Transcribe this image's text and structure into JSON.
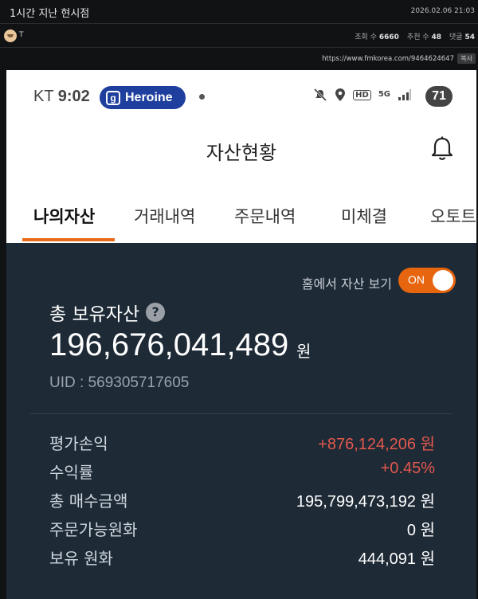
{
  "post": {
    "title": "1시간 지난 현시점",
    "date": "2026.02.06 21:03",
    "author": "T",
    "stats": {
      "views_label": "조회 수",
      "views": "6660",
      "likes_label": "추천 수",
      "likes": "48",
      "comments_label": "댓글",
      "comments": "54"
    },
    "url": "https://www.fmkorea.com/9464624647",
    "copy_label": "복사"
  },
  "phone": {
    "statusbar": {
      "carrier": "KT",
      "time": "9:02",
      "pill_label": "Heroine",
      "pill_icon": "g",
      "network": "5G",
      "hd": "HD",
      "battery": "71"
    },
    "app_title": "자산현황",
    "tabs": [
      "나의자산",
      "거래내역",
      "주문내역",
      "미체결",
      "오토트"
    ],
    "active_tab": 0,
    "toggle": {
      "label": "홈에서 자산 보기",
      "state": "ON"
    },
    "total": {
      "label": "총 보유자산",
      "amount": "196,676,041,489",
      "unit": "원",
      "uid": "UID : 569305717605"
    },
    "rows": [
      {
        "label": "평가손익",
        "value": "+876,124,206 원",
        "color": "#e2584d"
      },
      {
        "label": "수익률",
        "value": "+0.45%",
        "color": "#e2584d"
      },
      {
        "label": "총 매수금액",
        "value": "195,799,473,192 원",
        "color": "#ffffff"
      },
      {
        "label": "주문가능원화",
        "value": "0 원",
        "color": "#ffffff"
      },
      {
        "label": "보유 원화",
        "value": "444,091 원",
        "color": "#ffffff"
      }
    ],
    "colors": {
      "accent": "#e8650f",
      "panel": "#1e2a36",
      "pill": "#1f3f9e"
    }
  }
}
